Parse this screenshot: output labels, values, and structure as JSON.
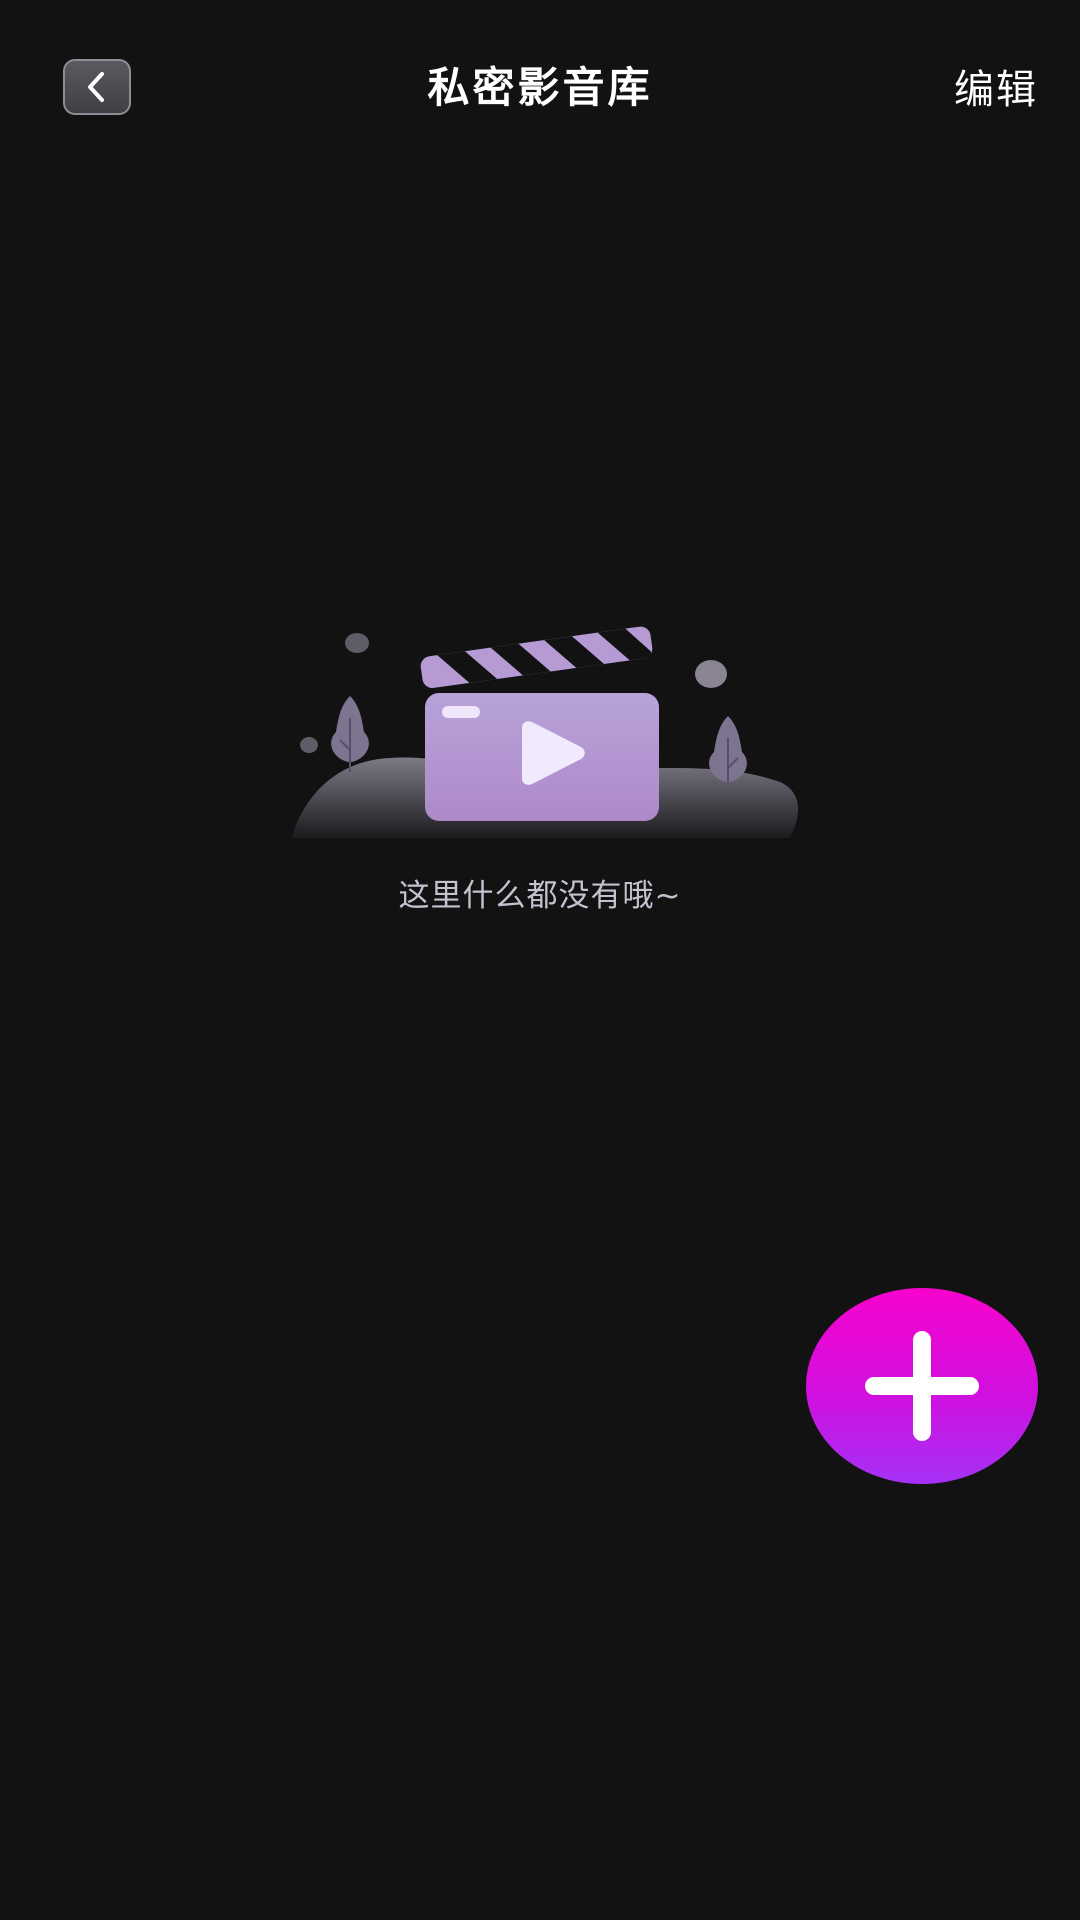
{
  "header": {
    "title": "私密影音库",
    "edit_label": "编辑"
  },
  "icons": {
    "back": "chevron-left-icon",
    "add": "plus-icon",
    "empty": "video-clapperboard-illustration"
  },
  "empty_state": {
    "message": "这里什么都没有哦~"
  },
  "colors": {
    "background": "#121213",
    "accent_top": "#f703cc",
    "accent_bottom": "#a531f5",
    "illustration_purple": "#b59ad4",
    "empty_text": "#c3c3d0"
  }
}
